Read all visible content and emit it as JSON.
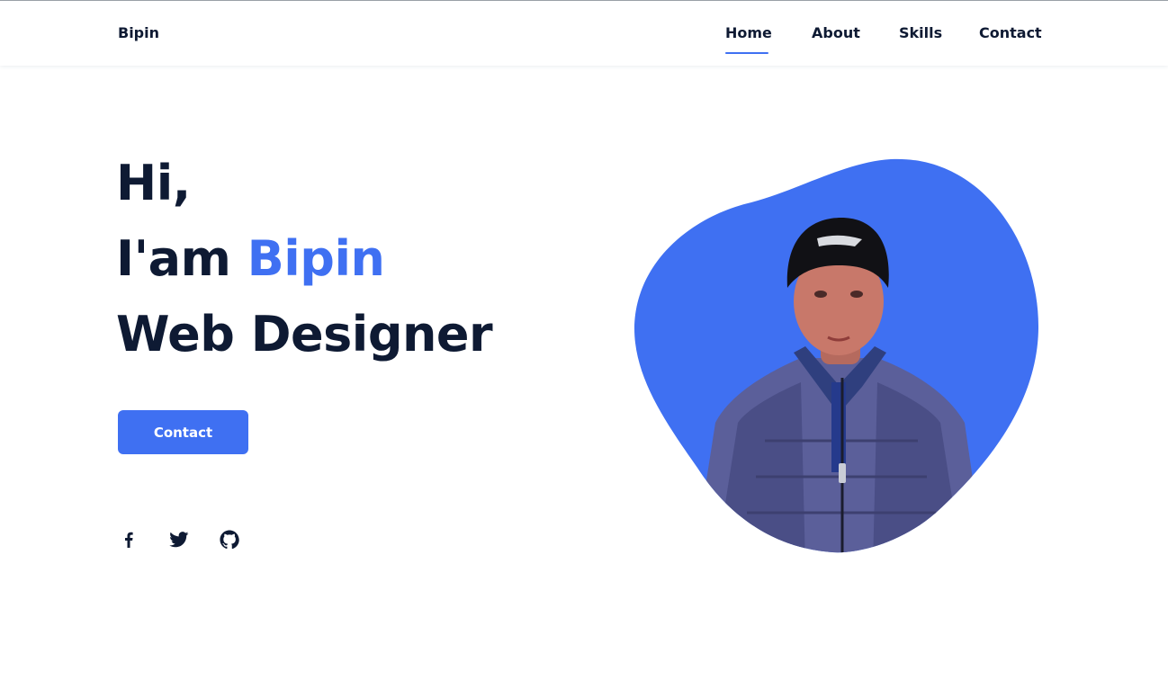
{
  "header": {
    "logo": "Bipin",
    "nav": [
      {
        "label": "Home",
        "active": true
      },
      {
        "label": "About",
        "active": false
      },
      {
        "label": "Skills",
        "active": false
      },
      {
        "label": "Contact",
        "active": false
      }
    ]
  },
  "hero": {
    "greeting": "Hi,",
    "intro_prefix": "I'am ",
    "name": "Bipin",
    "role": "Web Designer",
    "button_label": "Contact"
  },
  "social": [
    {
      "icon": "facebook-icon"
    },
    {
      "icon": "twitter-icon"
    },
    {
      "icon": "github-icon"
    }
  ],
  "colors": {
    "accent": "#3f70f2",
    "text": "#0e1a33",
    "background": "#ffffff"
  }
}
